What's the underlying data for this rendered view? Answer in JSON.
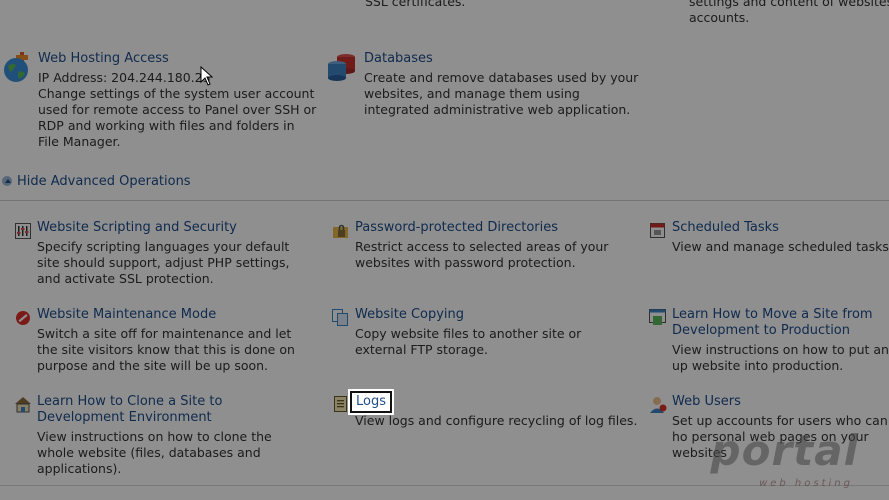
{
  "top_cut": {
    "left_text": "SSL certificates.",
    "right_line1": "settings and content of websites a",
    "right_line2": "accounts."
  },
  "hosting": {
    "title": "Web Hosting Access",
    "ip": "IP Address: 204.244.180.23",
    "desc": "Change settings of the system user account used for remote access to Panel over SSH or RDP and working with files and folders in File Manager."
  },
  "databases": {
    "title": "Databases",
    "desc": "Create and remove databases used by your websites, and manage them using integrated administrative web application."
  },
  "advanced": {
    "toggle": "Hide Advanced Operations"
  },
  "items": [
    {
      "title": "Website Scripting and Security",
      "desc": "Specify scripting languages your default site should support, adjust PHP settings, and activate SSL protection."
    },
    {
      "title": "Password-protected Directories",
      "desc": "Restrict access to selected areas of your websites with password protection."
    },
    {
      "title": "Scheduled Tasks",
      "desc": "View and manage scheduled tasks."
    },
    {
      "title": "Website Maintenance Mode",
      "desc": "Switch a site off for maintenance and let the site visitors know that this is done on purpose and the site will be up soon."
    },
    {
      "title": "Website Copying",
      "desc": "Copy website files to another site or external FTP storage."
    },
    {
      "title": "Learn How to Move a Site from Development to Production",
      "desc": "View instructions on how to put an up website into production."
    },
    {
      "title": "Learn How to Clone a Site to Development Environment",
      "desc": "View instructions on how to clone the whole website (files, databases and applications)."
    },
    {
      "title": "Logs",
      "desc": "View logs and configure recycling of log files."
    },
    {
      "title": "Web Users",
      "desc": "Set up accounts for users who can ho personal web pages on your websites"
    }
  ],
  "watermark": {
    "brand": "portal",
    "tagline": "web hosting"
  }
}
